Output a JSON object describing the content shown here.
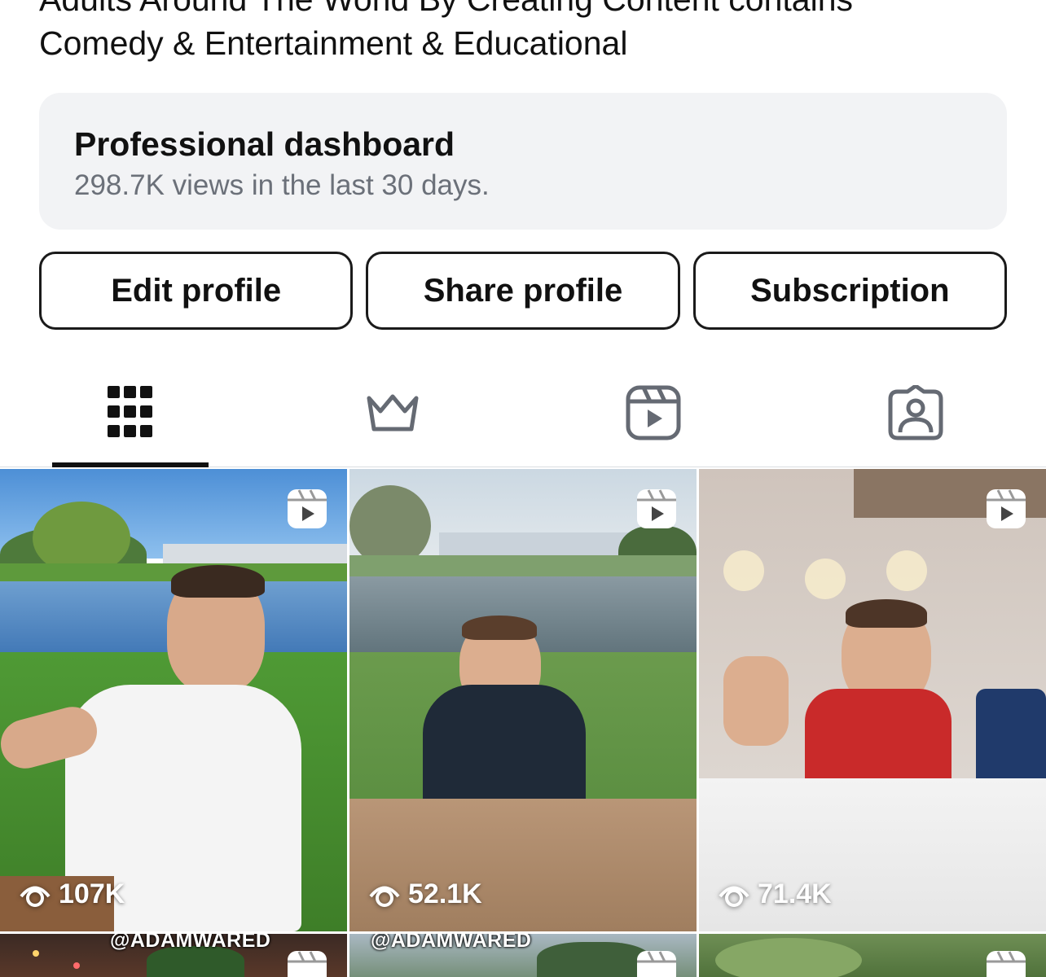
{
  "bio": {
    "line1": "Adults Around The World By Creating Content contains",
    "line2": "Comedy & Entertainment & Educational"
  },
  "dashboard": {
    "title": "Professional dashboard",
    "subtitle": "298.7K views in the last 30 days."
  },
  "actions": {
    "edit": "Edit profile",
    "share": "Share profile",
    "subscription": "Subscription"
  },
  "tabs": [
    {
      "icon": "grid-icon",
      "active": true
    },
    {
      "icon": "crown-icon",
      "active": false
    },
    {
      "icon": "reels-icon",
      "active": false
    },
    {
      "icon": "tagged-icon",
      "active": false
    }
  ],
  "posts": [
    {
      "views": "107K",
      "type": "reel"
    },
    {
      "views": "52.1K",
      "type": "reel"
    },
    {
      "views": "71.4K",
      "type": "reel"
    },
    {
      "watermark": "@ADAMWARED",
      "type": "reel"
    },
    {
      "watermark": "@ADAMWARED",
      "type": "reel"
    },
    {
      "type": "reel"
    }
  ],
  "colors": {
    "text": "#111111",
    "secondary_text": "#6b7079",
    "dashboard_bg": "#f2f3f5",
    "icon_gray": "#656a73"
  }
}
